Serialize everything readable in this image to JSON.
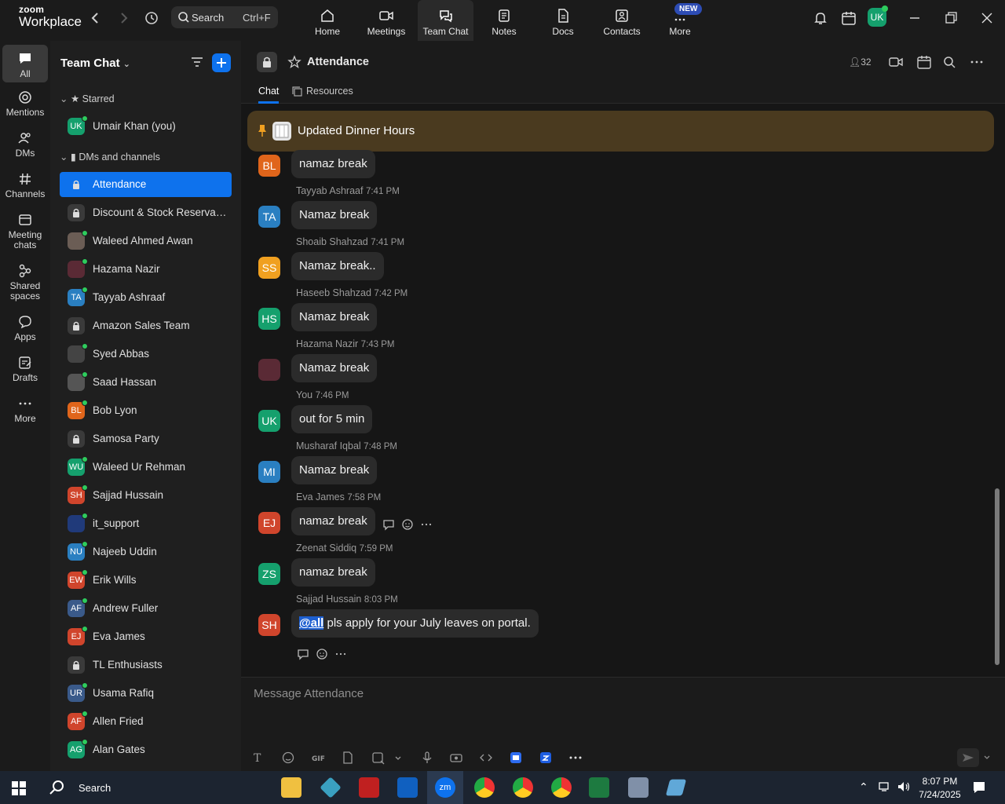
{
  "app": {
    "brand_small": "zoom",
    "brand_big": "Workplace"
  },
  "search": {
    "label": "Search",
    "shortcut": "Ctrl+F"
  },
  "top_tabs": [
    {
      "label": "Home",
      "icon": "home-icon"
    },
    {
      "label": "Meetings",
      "icon": "video-icon"
    },
    {
      "label": "Team Chat",
      "icon": "chat-icon"
    },
    {
      "label": "Notes",
      "icon": "notes-icon"
    },
    {
      "label": "Docs",
      "icon": "docs-icon"
    },
    {
      "label": "Contacts",
      "icon": "contacts-icon"
    },
    {
      "label": "More",
      "icon": "more-icon"
    }
  ],
  "new_badge": "NEW",
  "user_avatar": "UK",
  "rail": [
    {
      "label": "All"
    },
    {
      "label": "Mentions"
    },
    {
      "label": "DMs"
    },
    {
      "label": "Channels"
    },
    {
      "label": "Meeting chats"
    },
    {
      "label": "Shared spaces"
    },
    {
      "label": "Apps"
    },
    {
      "label": "Drafts"
    },
    {
      "label": "More"
    }
  ],
  "sidebar": {
    "title": "Team Chat",
    "starred_header": "Starred",
    "starred": [
      {
        "label": "Umair Khan (you)",
        "initials": "UK",
        "color": "#15a06d"
      }
    ],
    "dms_header": "DMs and channels",
    "items": [
      {
        "label": "Attendance",
        "kind": "channel"
      },
      {
        "label": "Discount & Stock Reservati...",
        "kind": "channel"
      },
      {
        "label": "Waleed Ahmed Awan",
        "initials": "",
        "color": "#6b5d55"
      },
      {
        "label": "Hazama Nazir",
        "initials": "",
        "color": "#5a2a35"
      },
      {
        "label": "Tayyab Ashraaf",
        "initials": "TA",
        "color": "#2a7fc1"
      },
      {
        "label": "Amazon Sales Team",
        "kind": "channel"
      },
      {
        "label": "Syed Abbas",
        "initials": "",
        "color": "#444"
      },
      {
        "label": "Saad Hassan",
        "initials": "",
        "color": "#555"
      },
      {
        "label": "Bob Lyon",
        "initials": "BL",
        "color": "#e0651b"
      },
      {
        "label": "Samosa Party",
        "kind": "channel"
      },
      {
        "label": "Waleed Ur Rehman",
        "initials": "WU",
        "color": "#15a06d"
      },
      {
        "label": "Sajjad Hussain",
        "initials": "SH",
        "color": "#d0452c"
      },
      {
        "label": "it_support",
        "initials": "",
        "color": "#203a7a"
      },
      {
        "label": "Najeeb Uddin",
        "initials": "NU",
        "color": "#2a7fc1"
      },
      {
        "label": "Erik Wills",
        "initials": "EW",
        "color": "#d0452c"
      },
      {
        "label": "Andrew Fuller",
        "initials": "AF",
        "color": "#3a5a8a"
      },
      {
        "label": "Eva James",
        "initials": "EJ",
        "color": "#d0452c"
      },
      {
        "label": "TL Enthusiasts",
        "kind": "channel"
      },
      {
        "label": "Usama Rafiq",
        "initials": "UR",
        "color": "#3a5a8a"
      },
      {
        "label": "Allen Fried",
        "initials": "AF",
        "color": "#d0452c"
      },
      {
        "label": "Alan Gates",
        "initials": "AG",
        "color": "#15a06d"
      }
    ]
  },
  "channel": {
    "title": "Attendance",
    "member_count": "32",
    "tabs": [
      "Chat",
      "Resources"
    ],
    "pinned": "Updated Dinner Hours",
    "composer_placeholder": "Message Attendance"
  },
  "messages": [
    {
      "name": "",
      "time": "",
      "initials": "BL",
      "color": "#e0651b",
      "text": "namaz break"
    },
    {
      "name": "Tayyab Ashraaf",
      "time": "7:41 PM",
      "initials": "TA",
      "color": "#2a7fc1",
      "text": "Namaz break"
    },
    {
      "name": "Shoaib Shahzad",
      "time": "7:41 PM",
      "initials": "SS",
      "color": "#f0a020",
      "text": "Namaz break.."
    },
    {
      "name": "Haseeb Shahzad",
      "time": "7:42 PM",
      "initials": "HS",
      "color": "#15a06d",
      "text": "Namaz break"
    },
    {
      "name": "Hazama Nazir",
      "time": "7:43 PM",
      "initials": "",
      "color": "#5a2a35",
      "text": "Namaz break"
    },
    {
      "name": "You",
      "time": "7:46 PM",
      "initials": "UK",
      "color": "#15a06d",
      "text": "out for 5 min"
    },
    {
      "name": "Musharaf Iqbal",
      "time": "7:48 PM",
      "initials": "MI",
      "color": "#2a7fc1",
      "text": "Namaz break"
    },
    {
      "name": "Eva James",
      "time": "7:58 PM",
      "initials": "EJ",
      "color": "#d0452c",
      "text": "namaz break"
    },
    {
      "name": "Zeenat Siddiq",
      "time": "7:59 PM",
      "initials": "ZS",
      "color": "#15a06d",
      "text": "namaz break"
    },
    {
      "name": "Sajjad Hussain",
      "time": "8:03 PM",
      "initials": "SH",
      "color": "#d0452c",
      "mention": "@all",
      "text": " pls apply for your July leaves on portal."
    }
  ],
  "taskbar": {
    "search": "Search",
    "time": "8:07 PM",
    "date": "7/24/2025"
  }
}
